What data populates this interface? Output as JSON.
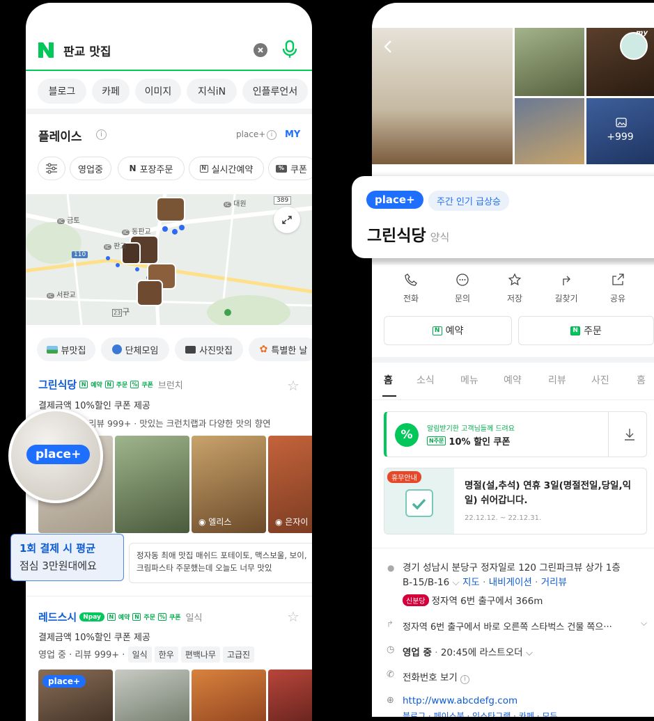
{
  "left": {
    "search": {
      "query": "판교 맛집"
    },
    "tabs": [
      "블로그",
      "카페",
      "이미지",
      "지식iN",
      "인플루언서"
    ],
    "places_header": {
      "title": "플레이스",
      "placeplus": "place+",
      "my": "MY"
    },
    "filters": [
      {
        "label": "영업중"
      },
      {
        "icon_text": "N",
        "label": "포장주문"
      },
      {
        "icon_text": "N",
        "label": "실시간예약"
      },
      {
        "icon_text": "%",
        "label": "쿠폰"
      }
    ],
    "map": {
      "labels": [
        "금토",
        "동판교",
        "판교",
        "대원",
        "서판교",
        "구"
      ],
      "road_numbers": [
        "389",
        "110",
        "23"
      ],
      "ic": "IC"
    },
    "categories": [
      "뷰맛집",
      "단체모임",
      "사진맛집",
      "특별한 날"
    ],
    "item1": {
      "name": "그린식당",
      "badges": [
        "예약",
        "주문",
        "쿠폰"
      ],
      "category": "브런치",
      "coupon": "결제금액 10%할인 쿠폰 제공",
      "meta": "리뷰 999+ · 맛있는 크런치랩과 다양한 맛의 향연",
      "photo_captions": [
        "엘리스",
        "은자이"
      ],
      "bubble": "place+",
      "callout_title": "1회 결제 시 평균",
      "callout_text": "점심 3만원대에요",
      "review": "정자동 최애 맛집 매쉬드 포테이토, 맥스보울, 보이, 크림파스타 주문했는데 오늘도 너무 맛있"
    },
    "item2": {
      "name": "레드스시",
      "npay": "pay",
      "badges": [
        "예약",
        "주문",
        "쿠폰"
      ],
      "category": "일식",
      "coupon": "결제금액 10%할인 쿠폰 제공",
      "meta_prefix": "영업 중 · 리뷰 999+ · ",
      "tags": [
        "일식",
        "한우",
        "편백나무",
        "고급진"
      ],
      "badge_place": "place+"
    }
  },
  "right": {
    "gallery": {
      "more": "+999",
      "my": "my"
    },
    "card": {
      "placeplus": "place+",
      "trend": "주간 인기 급상승",
      "name": "그린식당",
      "category": "양식"
    },
    "actions": [
      "전화",
      "문의",
      "저장",
      "길찾기",
      "공유"
    ],
    "buttons": [
      {
        "icon_text": "N",
        "label": "예약"
      },
      {
        "icon_text": "N",
        "label": "주문"
      }
    ],
    "tabs": [
      "홈",
      "소식",
      "메뉴",
      "예약",
      "리뷰",
      "사진",
      "홈"
    ],
    "coupon": {
      "small": "알림받기한 고객님들께 드려요",
      "badge": "N주문",
      "text": "10% 할인 쿠폰"
    },
    "holiday": {
      "tag": "휴무안내",
      "text": "명절(설,추석) 연휴 3일(명절전일,당일,익일) 쉬어갑니다.",
      "date": "22.12.12. ~ 22.12.31."
    },
    "info": {
      "address1": "경기 성남시 분당구 정자일로 120 그린파크뷰 상가 1층",
      "address2": "B-15/B-16",
      "links": [
        "지도",
        "내비게이션",
        "거리뷰"
      ],
      "line_badge": "신분당",
      "station": "정자역 6번 출구에서 366m",
      "direction": "정자역 6번 출구에서 바로 오른쪽 스타벅스 건물 쪽으···",
      "hours_status": "영업 중",
      "hours_text": "20:45에 라스트오더",
      "phone": "전화번호 보기",
      "url": "http://www.abcdefg.com",
      "sns": "블로그 · 페이스북 · 인스타그램 · 카페 · 모두"
    }
  },
  "colors": {
    "green": "#03c75a",
    "blue": "#1f6fff",
    "link": "#0c5bd6"
  }
}
